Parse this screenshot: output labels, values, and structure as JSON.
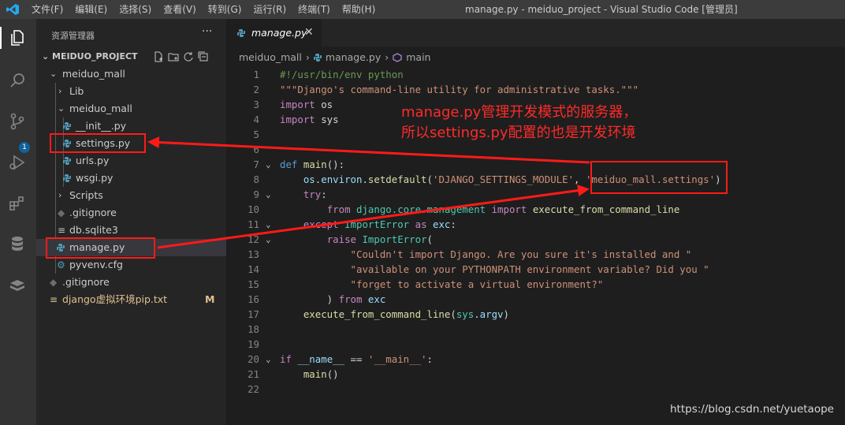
{
  "window": {
    "title": "manage.py - meiduo_project - Visual Studio Code [管理员]",
    "menu": [
      "文件(F)",
      "编辑(E)",
      "选择(S)",
      "查看(V)",
      "转到(G)",
      "运行(R)",
      "终端(T)",
      "帮助(H)"
    ]
  },
  "activity_bar": {
    "scm_badge": "1"
  },
  "sidebar": {
    "title": "资源管理器",
    "more": "···",
    "project": "MEIDUO_PROJECT",
    "tree": [
      {
        "label": "meiduo_mall",
        "kind": "folder-open"
      },
      {
        "label": "Lib",
        "kind": "folder-closed"
      },
      {
        "label": "meiduo_mall",
        "kind": "folder-open"
      },
      {
        "label": "__init__.py",
        "kind": "python"
      },
      {
        "label": "settings.py",
        "kind": "python"
      },
      {
        "label": "urls.py",
        "kind": "python"
      },
      {
        "label": "wsgi.py",
        "kind": "python"
      },
      {
        "label": "Scripts",
        "kind": "folder-closed"
      },
      {
        "label": ".gitignore",
        "kind": "gitignore"
      },
      {
        "label": "db.sqlite3",
        "kind": "db"
      },
      {
        "label": "manage.py",
        "kind": "python"
      },
      {
        "label": "pyvenv.cfg",
        "kind": "gear"
      },
      {
        "label": ".gitignore",
        "kind": "gitignore"
      },
      {
        "label": "django虚拟环境pip.txt",
        "kind": "text"
      }
    ],
    "modified_marker": "M"
  },
  "editor": {
    "tab_label": "manage.py",
    "tab_close": "✕",
    "breadcrumb": [
      "meiduo_mall",
      "manage.py",
      "main"
    ],
    "lines": [
      {
        "n": "1",
        "tokens": [
          [
            "#!/usr/bin/env python",
            "c-com"
          ]
        ]
      },
      {
        "n": "2",
        "tokens": [
          [
            "\"\"\"Django's command-line utility for administrative tasks.\"\"\"",
            "c-str"
          ]
        ]
      },
      {
        "n": "3",
        "tokens": [
          [
            "import",
            "c-ctl"
          ],
          [
            " os",
            "c-def"
          ]
        ]
      },
      {
        "n": "4",
        "tokens": [
          [
            "import",
            "c-ctl"
          ],
          [
            " sys",
            "c-def"
          ]
        ]
      },
      {
        "n": "5",
        "tokens": []
      },
      {
        "n": "6",
        "tokens": []
      },
      {
        "n": "7",
        "tokens": [
          [
            "def",
            "c-kw"
          ],
          [
            " ",
            "c-def"
          ],
          [
            "main",
            "c-fn"
          ],
          [
            "():",
            "c-def"
          ]
        ]
      },
      {
        "n": "8",
        "tokens": [
          [
            "    ",
            "c-def"
          ],
          [
            "os",
            "c-var"
          ],
          [
            ".",
            "c-def"
          ],
          [
            "environ",
            "c-var"
          ],
          [
            ".",
            "c-def"
          ],
          [
            "setdefault",
            "c-fn"
          ],
          [
            "(",
            "c-def"
          ],
          [
            "'DJANGO_SETTINGS_MODULE'",
            "c-str"
          ],
          [
            ", ",
            "c-def"
          ],
          [
            "'meiduo_mall.settings'",
            "c-str"
          ],
          [
            ")",
            "c-def"
          ]
        ]
      },
      {
        "n": "9",
        "tokens": [
          [
            "    ",
            "c-def"
          ],
          [
            "try",
            "c-ctl"
          ],
          [
            ":",
            "c-def"
          ]
        ]
      },
      {
        "n": "10",
        "tokens": [
          [
            "        ",
            "c-def"
          ],
          [
            "from",
            "c-ctl"
          ],
          [
            " ",
            "c-def"
          ],
          [
            "django.core.management",
            "c-cls"
          ],
          [
            " ",
            "c-def"
          ],
          [
            "import",
            "c-ctl"
          ],
          [
            " ",
            "c-def"
          ],
          [
            "execute_from_command_line",
            "c-fn"
          ]
        ]
      },
      {
        "n": "11",
        "tokens": [
          [
            "    ",
            "c-def"
          ],
          [
            "except",
            "c-ctl"
          ],
          [
            " ",
            "c-def"
          ],
          [
            "ImportError",
            "c-cls"
          ],
          [
            " ",
            "c-def"
          ],
          [
            "as",
            "c-ctl"
          ],
          [
            " ",
            "c-def"
          ],
          [
            "exc",
            "c-var"
          ],
          [
            ":",
            "c-def"
          ]
        ]
      },
      {
        "n": "12",
        "tokens": [
          [
            "        ",
            "c-def"
          ],
          [
            "raise",
            "c-ctl"
          ],
          [
            " ",
            "c-def"
          ],
          [
            "ImportError",
            "c-cls"
          ],
          [
            "(",
            "c-def"
          ]
        ]
      },
      {
        "n": "13",
        "tokens": [
          [
            "            ",
            "c-def"
          ],
          [
            "\"Couldn't import Django. Are you sure it's installed and \"",
            "c-str"
          ]
        ]
      },
      {
        "n": "14",
        "tokens": [
          [
            "            ",
            "c-def"
          ],
          [
            "\"available on your PYTHONPATH environment variable? Did you \"",
            "c-str"
          ]
        ]
      },
      {
        "n": "15",
        "tokens": [
          [
            "            ",
            "c-def"
          ],
          [
            "\"forget to activate a virtual environment?\"",
            "c-str"
          ]
        ]
      },
      {
        "n": "16",
        "tokens": [
          [
            "        ) ",
            "c-def"
          ],
          [
            "from",
            "c-ctl"
          ],
          [
            " ",
            "c-def"
          ],
          [
            "exc",
            "c-var"
          ]
        ]
      },
      {
        "n": "17",
        "tokens": [
          [
            "    ",
            "c-def"
          ],
          [
            "execute_from_command_line",
            "c-fn"
          ],
          [
            "(",
            "c-def"
          ],
          [
            "sys",
            "c-cls"
          ],
          [
            ".",
            "c-def"
          ],
          [
            "argv",
            "c-var"
          ],
          [
            ")",
            "c-def"
          ]
        ]
      },
      {
        "n": "18",
        "tokens": []
      },
      {
        "n": "19",
        "tokens": []
      },
      {
        "n": "20",
        "tokens": [
          [
            "if",
            "c-ctl"
          ],
          [
            " ",
            "c-def"
          ],
          [
            "__name__",
            "c-var"
          ],
          [
            " == ",
            "c-def"
          ],
          [
            "'__main__'",
            "c-str"
          ],
          [
            ":",
            "c-def"
          ]
        ]
      },
      {
        "n": "21",
        "tokens": [
          [
            "    ",
            "c-def"
          ],
          [
            "main",
            "c-fn"
          ],
          [
            "()",
            "c-def"
          ]
        ]
      },
      {
        "n": "22",
        "tokens": []
      }
    ]
  },
  "annotation": {
    "line1": "manage.py管理开发模式的服务器，",
    "line2": "所以settings.py配置的也是开发环境"
  },
  "watermark": "https://blog.csdn.net/yuetaope",
  "colors": {
    "annotation_red": "#ff1a1a",
    "python_icon": "#519aba",
    "vscode_blue": "#23a9f2",
    "modified": "#e2c08d"
  }
}
